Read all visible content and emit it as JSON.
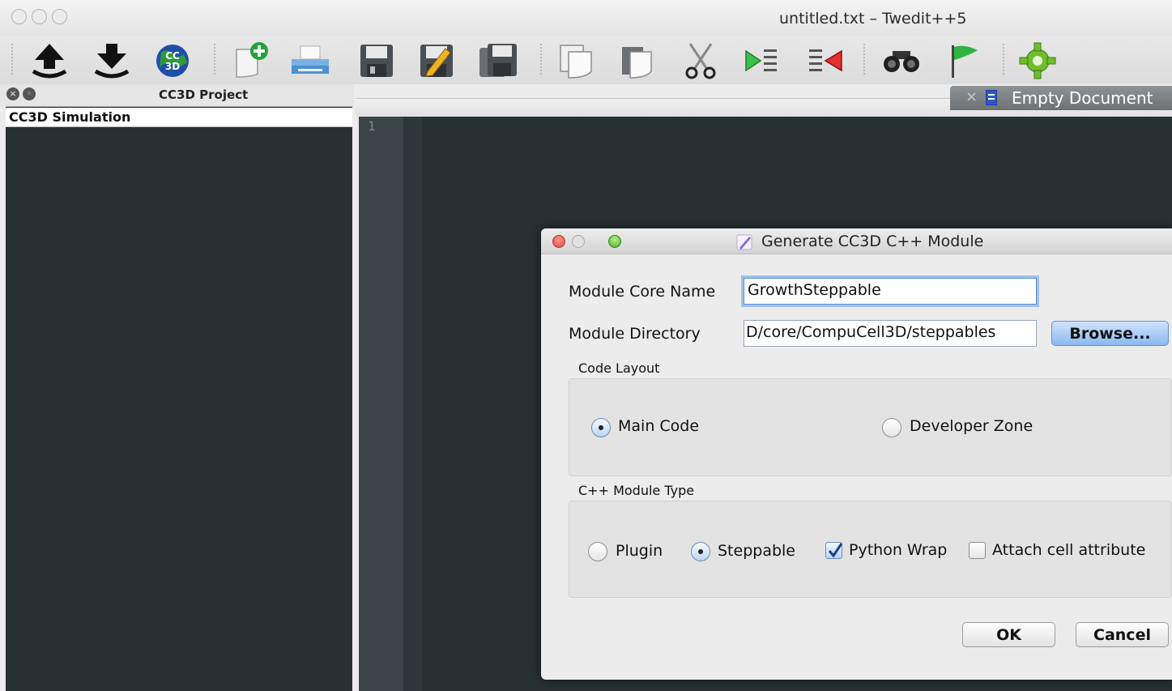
{
  "window": {
    "title": "untitled.txt – Twedit++5"
  },
  "toolbar": {
    "buttons": [
      "upload-icon",
      "download-icon",
      "cc3d-globe-icon",
      "new-file-icon",
      "print-icon",
      "save-icon",
      "save-as-icon",
      "save-all-icon",
      "copy-icon",
      "paste-icon",
      "cut-icon",
      "indent-icon",
      "unindent-icon",
      "find-icon",
      "bookmark-flag-icon",
      "settings-gear-icon"
    ]
  },
  "project_panel": {
    "title": "CC3D Project",
    "items": [
      "CC3D Simulation"
    ]
  },
  "editor": {
    "tab_label": "Empty Document",
    "tab_close": "×",
    "line_numbers": [
      "1"
    ]
  },
  "dialog": {
    "title": "Generate CC3D C++ Module",
    "module_core_name_label": "Module Core Name",
    "module_core_name_value": "GrowthSteppable",
    "module_directory_label": "Module Directory",
    "module_directory_value": "D/core/CompuCell3D/steppables",
    "browse_label": "Browse...",
    "code_layout": {
      "label": "Code Layout",
      "options": [
        {
          "label": "Main Code",
          "selected": true
        },
        {
          "label": "Developer Zone",
          "selected": false
        }
      ]
    },
    "module_type": {
      "label": "C++ Module Type",
      "options": [
        {
          "label": "Plugin",
          "selected": false
        },
        {
          "label": "Steppable",
          "selected": true
        }
      ],
      "checkboxes": [
        {
          "label": "Python Wrap",
          "checked": true
        },
        {
          "label": "Attach cell attribute",
          "checked": false
        }
      ]
    },
    "ok_label": "OK",
    "cancel_label": "Cancel"
  },
  "colors": {
    "editor_bg": "#273033",
    "accent_blue": "#8ab9f1",
    "tab_bg": "#7f8285"
  }
}
